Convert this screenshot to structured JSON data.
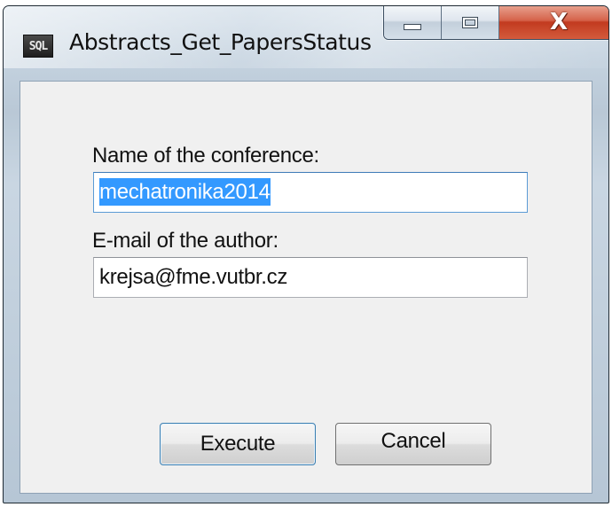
{
  "window": {
    "title": "Abstracts_Get_PapersStatus",
    "icon_label": "SQL",
    "icon": "sql-app-icon",
    "caption_buttons": {
      "minimize_icon": "minimize-icon",
      "maximize_icon": "maximize-icon",
      "close_icon": "close-icon",
      "close_glyph": "X"
    }
  },
  "form": {
    "conference_label": "Name of the conference:",
    "conference_value": "mechatronika2014",
    "email_label": "E-mail of the author:",
    "email_value": "krejsa@fme.vutbr.cz"
  },
  "buttons": {
    "execute_label": "Execute",
    "cancel_label": "Cancel"
  },
  "colors": {
    "selection": "#3399ff",
    "close_button": "#c23a1f",
    "focus_border": "#5b9bd5"
  }
}
